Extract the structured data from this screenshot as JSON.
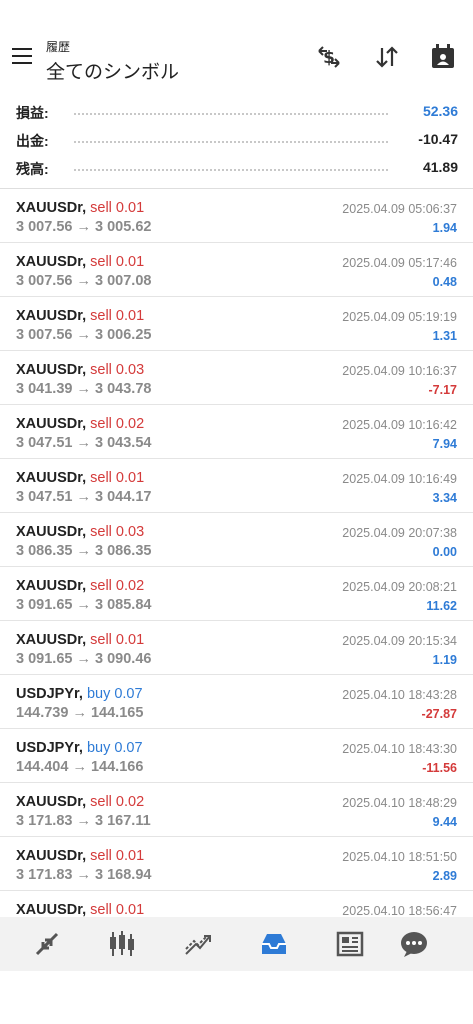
{
  "header": {
    "subtitle": "履歴",
    "title": "全てのシンボル",
    "icons": [
      "menu-icon",
      "currency-exchange-icon",
      "sort-icon",
      "calendar-icon"
    ]
  },
  "summary": {
    "profit_label": "損益:",
    "profit_value": "52.36",
    "withdrawal_label": "出金:",
    "withdrawal_value": "-10.47",
    "balance_label": "残高:",
    "balance_value": "41.89"
  },
  "deals": [
    {
      "symbol": "XAUUSDr,",
      "side": "sell 0.01",
      "type": "sell",
      "prices": "3 007.56 → 3 005.62",
      "time": "2025.04.09 05:06:37",
      "profit": "1.94",
      "sign": "pos"
    },
    {
      "symbol": "XAUUSDr,",
      "side": "sell 0.01",
      "type": "sell",
      "prices": "3 007.56 → 3 007.08",
      "time": "2025.04.09 05:17:46",
      "profit": "0.48",
      "sign": "pos"
    },
    {
      "symbol": "XAUUSDr,",
      "side": "sell 0.01",
      "type": "sell",
      "prices": "3 007.56 → 3 006.25",
      "time": "2025.04.09 05:19:19",
      "profit": "1.31",
      "sign": "pos"
    },
    {
      "symbol": "XAUUSDr,",
      "side": "sell 0.03",
      "type": "sell",
      "prices": "3 041.39 → 3 043.78",
      "time": "2025.04.09 10:16:37",
      "profit": "-7.17",
      "sign": "neg"
    },
    {
      "symbol": "XAUUSDr,",
      "side": "sell 0.02",
      "type": "sell",
      "prices": "3 047.51 → 3 043.54",
      "time": "2025.04.09 10:16:42",
      "profit": "7.94",
      "sign": "pos"
    },
    {
      "symbol": "XAUUSDr,",
      "side": "sell 0.01",
      "type": "sell",
      "prices": "3 047.51 → 3 044.17",
      "time": "2025.04.09 10:16:49",
      "profit": "3.34",
      "sign": "pos"
    },
    {
      "symbol": "XAUUSDr,",
      "side": "sell 0.03",
      "type": "sell",
      "prices": "3 086.35 → 3 086.35",
      "time": "2025.04.09 20:07:38",
      "profit": "0.00",
      "sign": "pos"
    },
    {
      "symbol": "XAUUSDr,",
      "side": "sell 0.02",
      "type": "sell",
      "prices": "3 091.65 → 3 085.84",
      "time": "2025.04.09 20:08:21",
      "profit": "11.62",
      "sign": "pos"
    },
    {
      "symbol": "XAUUSDr,",
      "side": "sell 0.01",
      "type": "sell",
      "prices": "3 091.65 → 3 090.46",
      "time": "2025.04.09 20:15:34",
      "profit": "1.19",
      "sign": "pos"
    },
    {
      "symbol": "USDJPYr,",
      "side": "buy 0.07",
      "type": "buy",
      "prices": "144.739 → 144.165",
      "time": "2025.04.10 18:43:28",
      "profit": "-27.87",
      "sign": "neg"
    },
    {
      "symbol": "USDJPYr,",
      "side": "buy 0.07",
      "type": "buy",
      "prices": "144.404 → 144.166",
      "time": "2025.04.10 18:43:30",
      "profit": "-11.56",
      "sign": "neg"
    },
    {
      "symbol": "XAUUSDr,",
      "side": "sell 0.02",
      "type": "sell",
      "prices": "3 171.83 → 3 167.11",
      "time": "2025.04.10 18:48:29",
      "profit": "9.44",
      "sign": "pos"
    },
    {
      "symbol": "XAUUSDr,",
      "side": "sell 0.01",
      "type": "sell",
      "prices": "3 171.83 → 3 168.94",
      "time": "2025.04.10 18:51:50",
      "profit": "2.89",
      "sign": "pos"
    },
    {
      "symbol": "XAUUSDr,",
      "side": "sell 0.01",
      "type": "sell",
      "prices": "",
      "time": "2025.04.10 18:56:47",
      "profit": "",
      "sign": "pos"
    }
  ],
  "bottom_nav": {
    "icons": [
      "quotes-icon",
      "chart-icon",
      "trade-icon",
      "history-icon",
      "news-icon",
      "chat-icon"
    ],
    "active": "history-icon",
    "active_color": "#2e7bd6",
    "inactive_color": "#555555"
  },
  "colors": {
    "profit_positive": "#2e7bd6",
    "profit_negative": "#d43a3a",
    "sell": "#d43a3a",
    "buy": "#2e7bd6"
  }
}
